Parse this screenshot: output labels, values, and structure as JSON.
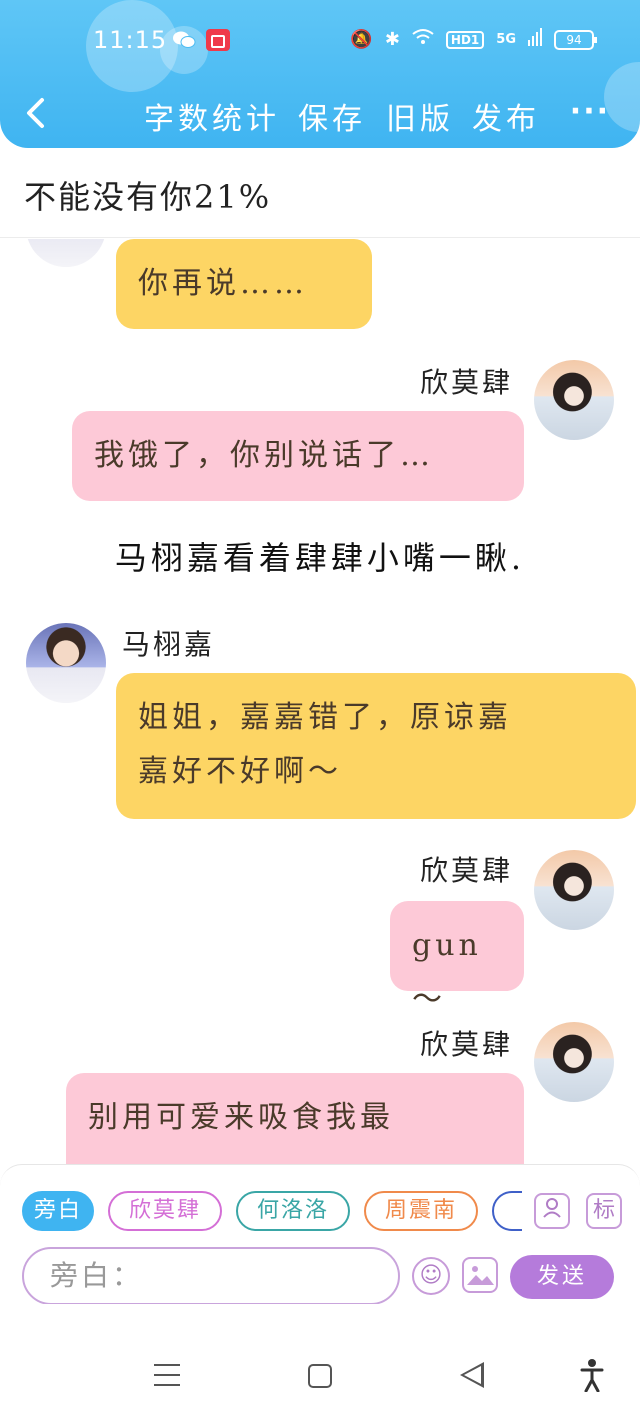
{
  "status_bar": {
    "time": "11:15",
    "network": "5G",
    "battery": "94",
    "hd_label": "HD1"
  },
  "navbar": {
    "items": [
      "字数统计",
      "保存",
      "旧版",
      "发布"
    ],
    "more": "···"
  },
  "story_title": "不能没有你21%",
  "chat": {
    "bubble_top": {
      "text": "你再说……"
    },
    "msg1": {
      "name": "欣莫肆",
      "text": "我饿了，你别说话了…"
    },
    "narration": "马栩嘉看着肆肆小嘴一瞅.",
    "msg2": {
      "name": "马栩嘉",
      "text_line1": "姐姐，嘉嘉错了，原谅嘉",
      "text_line2": "嘉好不好啊～"
    },
    "msg3": {
      "name": "欣莫肆",
      "text": "gun～"
    },
    "msg4": {
      "name": "欣莫肆",
      "text": "别用可爱来吸食我最"
    }
  },
  "composer": {
    "chips": [
      "旁白",
      "欣莫肆",
      "何洛洛",
      "周震南"
    ],
    "chip_colors": [
      "#3fb4f1",
      "#d46fd6",
      "#3aa6a6",
      "#f08a4b"
    ],
    "person_icon": "person-icon",
    "mark_label": "标",
    "input_placeholder": "旁白：",
    "emoji_icon": "smile-icon",
    "image_icon": "image-icon",
    "send_label": "发送"
  }
}
